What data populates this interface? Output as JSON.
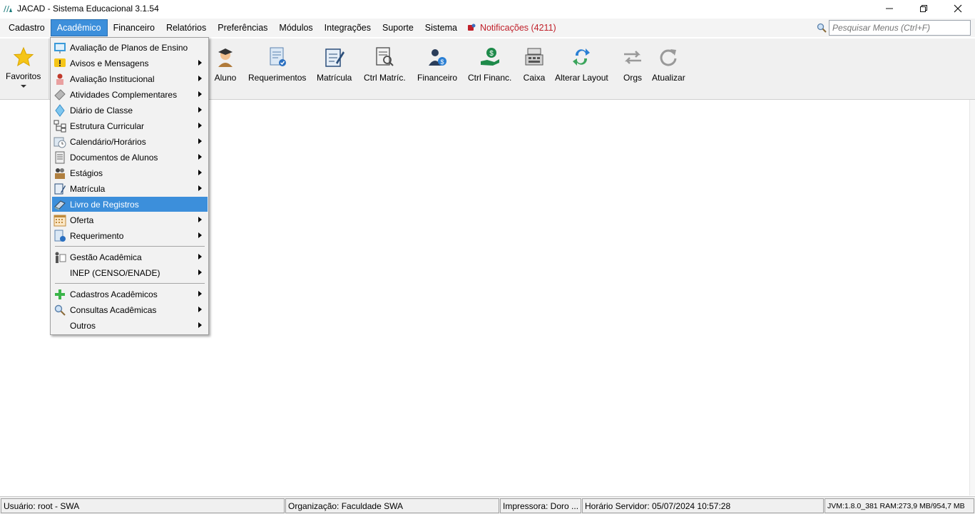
{
  "window": {
    "title": "JACAD - Sistema Educacional 3.1.54",
    "controls": [
      "minimize-icon",
      "restore-icon",
      "close-icon"
    ]
  },
  "menubar": {
    "items": [
      {
        "label": "Cadastro"
      },
      {
        "label": "Acadêmico"
      },
      {
        "label": "Financeiro"
      },
      {
        "label": "Relatórios"
      },
      {
        "label": "Preferências"
      },
      {
        "label": "Módulos"
      },
      {
        "label": "Integrações"
      },
      {
        "label": "Suporte"
      },
      {
        "label": "Sistema"
      }
    ],
    "active_index": 1,
    "notifications": "Notificações (4211)",
    "search_placeholder": "Pesquisar Menus (Ctrl+F)"
  },
  "toolbar": {
    "favorites": "Favoritos",
    "buttons": [
      {
        "label": "Aluno",
        "icon": "student-icon"
      },
      {
        "label": "Requerimentos",
        "icon": "document-check-icon"
      },
      {
        "label": "Matrícula",
        "icon": "enrollment-pen-icon"
      },
      {
        "label": "Ctrl Matríc.",
        "icon": "document-search-icon"
      },
      {
        "label": "Financeiro",
        "icon": "person-money-icon"
      },
      {
        "label": "Ctrl Financ.",
        "icon": "money-hand-icon"
      },
      {
        "label": "Caixa",
        "icon": "cash-register-icon"
      },
      {
        "label": "Alterar Layout",
        "icon": "layout-swap-icon"
      },
      {
        "label": "Orgs",
        "icon": "arrows-exchange-icon"
      },
      {
        "label": "Atualizar",
        "icon": "refresh-icon"
      }
    ]
  },
  "dropdown": {
    "items": [
      {
        "label": "Avaliação de Planos de Ensino",
        "icon": "plan-evaluation-icon",
        "submenu": false
      },
      {
        "label": "Avisos e Mensagens",
        "icon": "warning-message-icon",
        "submenu": true
      },
      {
        "label": "Avaliação Institucional",
        "icon": "institutional-evaluation-icon",
        "submenu": true
      },
      {
        "label": "Atividades Complementares",
        "icon": "activities-icon",
        "submenu": true
      },
      {
        "label": "Diário de Classe",
        "icon": "class-diary-icon",
        "submenu": true
      },
      {
        "label": "Estrutura Curricular",
        "icon": "curriculum-tree-icon",
        "submenu": true
      },
      {
        "label": "Calendário/Horários",
        "icon": "calendar-clock-icon",
        "submenu": true
      },
      {
        "label": "Documentos de Alunos",
        "icon": "student-documents-icon",
        "submenu": true
      },
      {
        "label": "Estágios",
        "icon": "internship-icon",
        "submenu": true
      },
      {
        "label": "Matrícula",
        "icon": "enrollment-icon",
        "submenu": true
      },
      {
        "label": "Livro de Registros",
        "icon": "record-book-icon",
        "submenu": false
      },
      {
        "label": "Oferta",
        "icon": "offer-calendar-icon",
        "submenu": true
      },
      {
        "label": "Requerimento",
        "icon": "request-icon",
        "submenu": true
      },
      {
        "label": "Gestão Acadêmica",
        "icon": "academic-management-icon",
        "submenu": true
      },
      {
        "label": "INEP (CENSO/ENADE)",
        "icon": "",
        "submenu": true
      },
      {
        "label": "Cadastros Acadêmicos",
        "icon": "green-plus-icon",
        "submenu": true
      },
      {
        "label": "Consultas Acadêmicas",
        "icon": "magnifier-icon",
        "submenu": true
      },
      {
        "label": "Outros",
        "icon": "",
        "submenu": true
      }
    ],
    "highlight_index": 10
  },
  "statusbar": {
    "user": "Usuário: root - SWA",
    "organization": "Organização: Faculdade SWA",
    "printer": "Impressora: Doro ...",
    "server_time": "Horário Servidor: 05/07/2024 10:57:28",
    "jvm": "JVM:1.8.0_381  RAM:273,9 MB/954,7 MB"
  },
  "colors": {
    "highlight": "#3c8fdb",
    "notification": "#c0202a",
    "menubar_bg": "#f4f4f4",
    "toolbar_bg": "#f0f0f0"
  }
}
